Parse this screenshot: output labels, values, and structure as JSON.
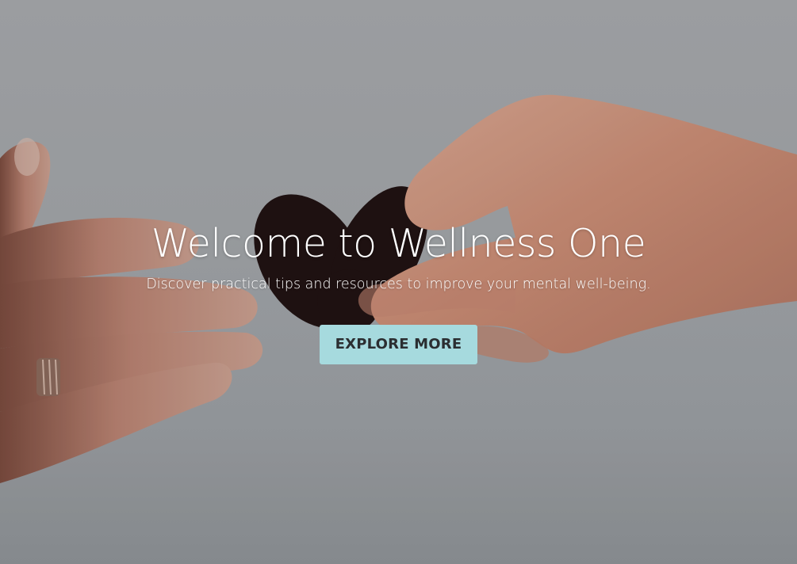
{
  "hero": {
    "title": "Welcome to Wellness One",
    "subtitle": "Discover practical tips and resources to improve your mental well-being.",
    "cta_label": "EXPLORE MORE",
    "image_icon": "hands-heart-image"
  },
  "colors": {
    "cta_background": "#a6dade",
    "cta_text": "#2b2e31",
    "text": "#ffffff",
    "background": "#a3a6a9",
    "heart": "#1f1110",
    "skin": "#d49b82"
  }
}
